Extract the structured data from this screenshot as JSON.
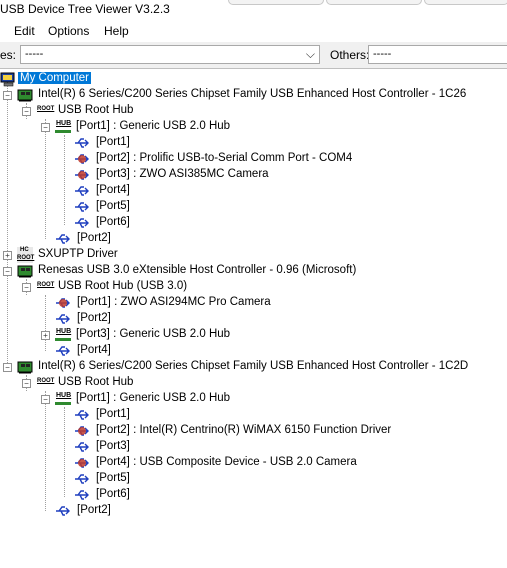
{
  "window": {
    "title": "USB Device Tree Viewer V3.2.3"
  },
  "menu": {
    "edit": "Edit",
    "options": "Options",
    "help": "Help"
  },
  "filters": {
    "devices_label": "es:",
    "devices_value": "-----",
    "others_label": "Others:",
    "others_value": "-----"
  },
  "tree": {
    "root": "My Computer",
    "ctrl1": {
      "label": "Intel(R) 6 Series/C200 Series Chipset Family USB Enhanced Host Controller - 1C26",
      "roothub": "USB Root Hub",
      "port1": "[Port1] : Generic USB 2.0 Hub",
      "sub": [
        "[Port1]",
        "[Port2] : Prolific USB-to-Serial Comm Port - COM4",
        "[Port3] : ZWO ASI385MC Camera",
        "[Port4]",
        "[Port5]",
        "[Port6]"
      ],
      "port2": "[Port2]"
    },
    "sxuptp": "SXUPTP Driver",
    "ctrl2": {
      "label": "Renesas USB 3.0 eXtensible Host Controller - 0.96 (Microsoft)",
      "roothub": "USB Root Hub (USB 3.0)",
      "ports": [
        "[Port1] : ZWO ASI294MC Pro Camera",
        "[Port2]",
        "[Port3] : Generic USB 2.0 Hub",
        "[Port4]"
      ]
    },
    "ctrl3": {
      "label": "Intel(R) 6 Series/C200 Series Chipset Family USB Enhanced Host Controller - 1C2D",
      "roothub": "USB Root Hub",
      "port1": "[Port1] : Generic USB 2.0 Hub",
      "sub": [
        "[Port1]",
        "[Port2] : Intel(R) Centrino(R) WiMAX 6150 Function Driver",
        "[Port3]",
        "[Port4] : USB Composite Device - USB 2.0 Camera",
        "[Port5]",
        "[Port6]"
      ],
      "port2": "[Port2]"
    }
  },
  "icons": {
    "hub_text": "HUB",
    "root_text": "ROOT",
    "hc_text": "HC"
  }
}
